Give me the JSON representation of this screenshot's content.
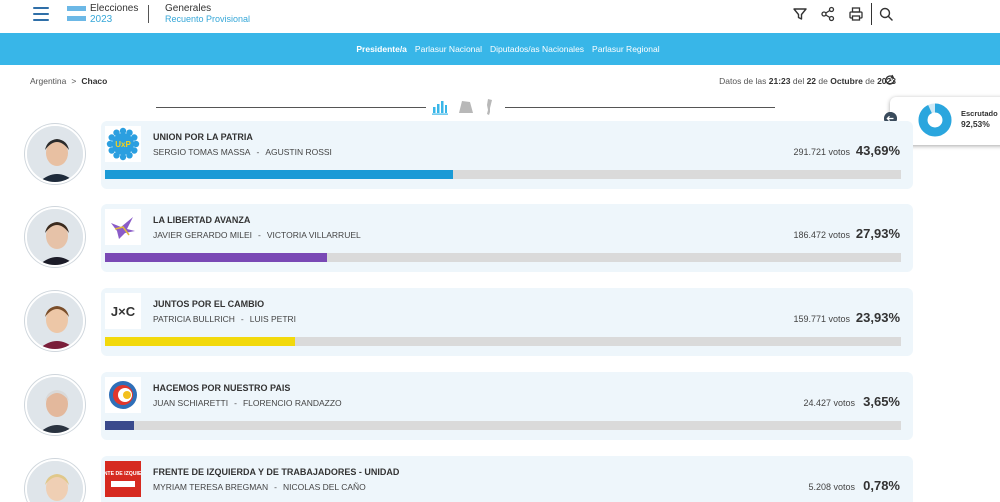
{
  "header": {
    "brand_title": "Elecciones",
    "brand_year": "2023",
    "scope_title": "Generales",
    "scope_subtitle": "Recuento Provisional"
  },
  "nav": {
    "tabs": [
      {
        "label": "Presidente/a",
        "active": true
      },
      {
        "label": "Parlasur Nacional",
        "active": false
      },
      {
        "label": "Diputados/as Nacionales",
        "active": false
      },
      {
        "label": "Parlasur Regional",
        "active": false
      }
    ]
  },
  "breadcrumb": {
    "root": "Argentina",
    "separator": ">",
    "current": "Chaco"
  },
  "updated": {
    "prefix": "Datos de las",
    "time": "21:23",
    "mid": "del",
    "day": "22",
    "of": "de",
    "month": "Octubre",
    "of2": "de",
    "year": "2023"
  },
  "escrutado": {
    "label": "Escrutado",
    "value": "92,53%",
    "fraction": 0.9253
  },
  "results": [
    {
      "party": "UNION POR LA PATRIA",
      "candidate1": "SERGIO TOMAS MASSA",
      "separator": "-",
      "candidate2": "AGUSTIN ROSSI",
      "votes": "291.721 votos",
      "percent": "43,69%",
      "share": 0.4369,
      "color": "#1a9ad6",
      "logo_text": "UxP"
    },
    {
      "party": "LA LIBERTAD AVANZA",
      "candidate1": "JAVIER GERARDO MILEI",
      "separator": "-",
      "candidate2": "VICTORIA VILLARRUEL",
      "votes": "186.472 votos",
      "percent": "27,93%",
      "share": 0.2793,
      "color": "#7a49b5",
      "logo_text": ""
    },
    {
      "party": "JUNTOS POR EL CAMBIO",
      "candidate1": "PATRICIA BULLRICH",
      "separator": "-",
      "candidate2": "LUIS PETRI",
      "votes": "159.771 votos",
      "percent": "23,93%",
      "share": 0.2393,
      "color": "#f2d90c",
      "logo_text": "J×C"
    },
    {
      "party": "HACEMOS POR NUESTRO PAIS",
      "candidate1": "JUAN SCHIARETTI",
      "separator": "-",
      "candidate2": "FLORENCIO RANDAZZO",
      "votes": "24.427 votos",
      "percent": "3,65%",
      "share": 0.0365,
      "color": "#3a4a8c",
      "logo_text": ""
    },
    {
      "party": "FRENTE DE IZQUIERDA Y DE TRABAJADORES - UNIDAD",
      "candidate1": "MYRIAM TERESA BREGMAN",
      "separator": "-",
      "candidate2": "NICOLAS DEL CAÑO",
      "votes": "5.208 votos",
      "percent": "0,78%",
      "share": 0.0078,
      "color": "#d62a20",
      "logo_text": "FRENTE DE IZQUIERDA"
    }
  ]
}
